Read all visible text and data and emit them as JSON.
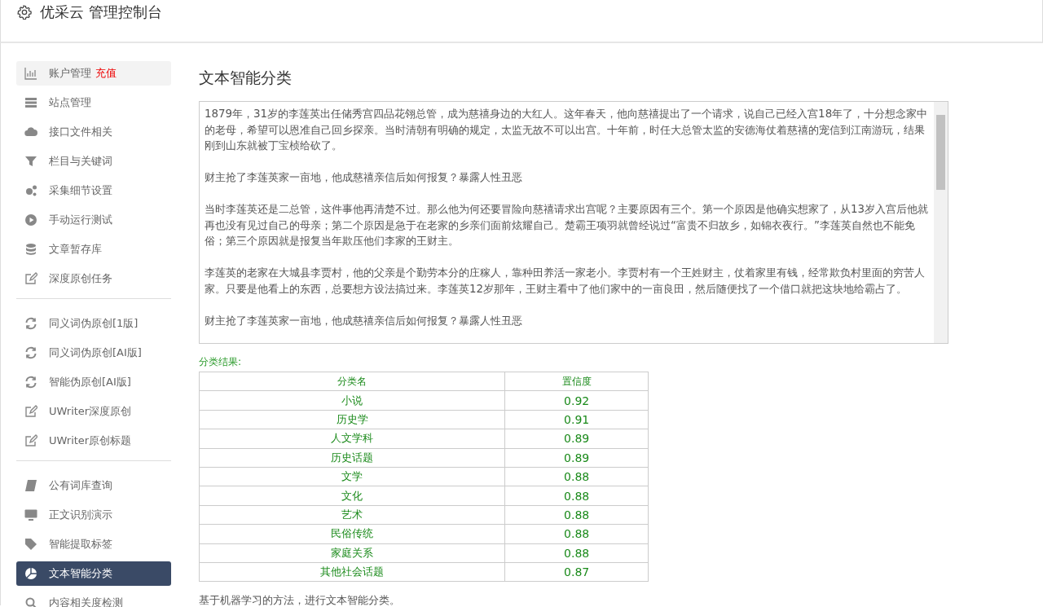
{
  "header": {
    "title": "优采云 管理控制台"
  },
  "sidebar": {
    "groups": [
      {
        "items": [
          {
            "label": "账户管理",
            "badge": "充值",
            "kind": "chart",
            "selected": false
          },
          {
            "label": "站点管理",
            "kind": "server",
            "selected": false
          },
          {
            "label": "接口文件相关",
            "kind": "cloud",
            "selected": false
          },
          {
            "label": "栏目与关键词",
            "kind": "filter",
            "selected": false
          },
          {
            "label": "采集细节设置",
            "kind": "gears",
            "selected": false
          },
          {
            "label": "手动运行测试",
            "kind": "play",
            "selected": false
          },
          {
            "label": "文章暂存库",
            "kind": "database",
            "selected": false
          },
          {
            "label": "深度原创任务",
            "kind": "edit",
            "selected": false
          }
        ]
      },
      {
        "items": [
          {
            "label": "同义词伪原创[1版]",
            "kind": "refresh",
            "selected": false
          },
          {
            "label": "同义词伪原创[AI版]",
            "kind": "refresh",
            "selected": false
          },
          {
            "label": "智能伪原创[AI版]",
            "kind": "refresh",
            "selected": false
          },
          {
            "label": "UWriter深度原创",
            "kind": "edit",
            "selected": false
          },
          {
            "label": "UWriter原创标题",
            "kind": "edit",
            "selected": false
          }
        ]
      },
      {
        "items": [
          {
            "label": "公有词库查询",
            "kind": "book",
            "selected": false
          },
          {
            "label": "正文识别演示",
            "kind": "monitor",
            "selected": false
          },
          {
            "label": "智能提取标签",
            "kind": "tag",
            "selected": false
          },
          {
            "label": "文本智能分类",
            "kind": "pie",
            "selected": true
          },
          {
            "label": "内容相关度检测",
            "kind": "search",
            "selected": false
          }
        ]
      }
    ]
  },
  "main": {
    "title": "文本智能分类",
    "text_input": {
      "paragraphs": [
        "1879年，31岁的李莲英出任储秀宫四品花翎总管，成为慈禧身边的大红人。这年春天，他向慈禧提出了一个请求，说自己已经入宫18年了，十分想念家中的老母，希望可以恩准自己回乡探亲。当时清朝有明确的规定，太监无故不可以出宫。十年前，时任大总管太监的安德海仗着慈禧的宠信到江南游玩，结果刚到山东就被丁宝桢给砍了。",
        "财主抢了李莲英家一亩地，他成慈禧亲信后如何报复？暴露人性丑恶",
        "当时李莲英还是二总管，这件事他再清楚不过。那么他为何还要冒险向慈禧请求出宫呢？主要原因有三个。第一个原因是他确实想家了，从13岁入宫后他就再也没有见过自己的母亲；第二个原因是急于在老家的乡亲们面前炫耀自己。楚霸王项羽就曾经说过“富贵不归故乡，如锦衣夜行。”李莲英自然也不能免俗；第三个原因就是报复当年欺压他们李家的王财主。",
        "李莲英的老家在大城县李贾村，他的父亲是个勤劳本分的庄稼人，靠种田养活一家老小。李贾村有一个王姓财主，仗着家里有钱，经常欺负村里面的穷苦人家。只要是他看上的东西，总要想方设法搞过来。李莲英12岁那年，王财主看中了他们家中的一亩良田，然后随便找了一个借口就把这块地给霸占了。",
        "财主抢了李莲英家一亩地，他成慈禧亲信后如何报复？暴露人性丑恶"
      ]
    },
    "result_label": "分类结果:",
    "table": {
      "columns": [
        "分类名",
        "置信度"
      ],
      "rows": [
        [
          "小说",
          "0.92"
        ],
        [
          "历史学",
          "0.91"
        ],
        [
          "人文学科",
          "0.89"
        ],
        [
          "历史话题",
          "0.89"
        ],
        [
          "文学",
          "0.88"
        ],
        [
          "文化",
          "0.88"
        ],
        [
          "艺术",
          "0.88"
        ],
        [
          "民俗传统",
          "0.88"
        ],
        [
          "家庭关系",
          "0.88"
        ],
        [
          "其他社会话题",
          "0.87"
        ]
      ]
    },
    "footnote": "基于机器学习的方法，进行文本智能分类。"
  }
}
